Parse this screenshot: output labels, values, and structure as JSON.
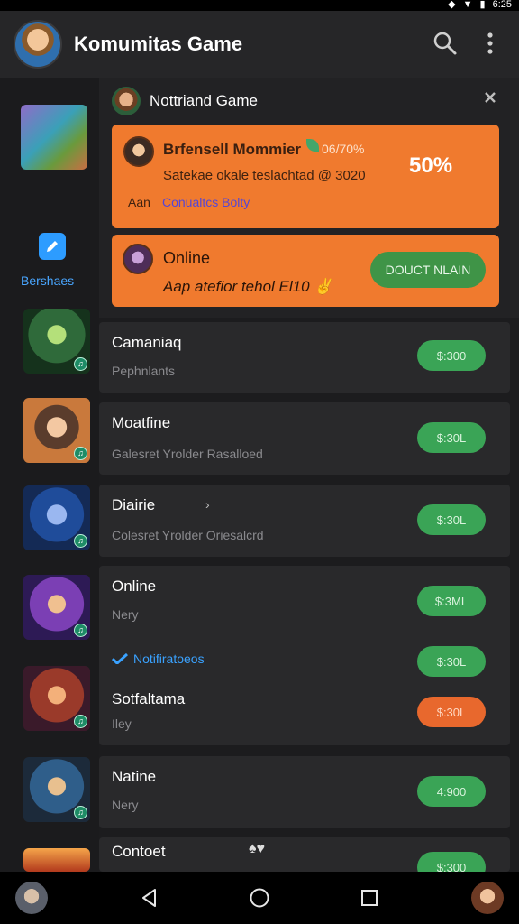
{
  "status_bar": {
    "time": "6:25"
  },
  "appbar": {
    "title": "Komumitas Game",
    "icons": [
      "search-icon",
      "more-vert-icon"
    ]
  },
  "sidebar": {
    "nav_label": "Bershaes"
  },
  "notification_panel": {
    "title": "Nottriand Game",
    "card1": {
      "title": "Brfensell Mommier",
      "meta": "06/70%",
      "text": "Satekae okale teslachtad @ 3020",
      "percent": "50%",
      "sub_prefix": "Aan",
      "sub_link": "Conualtcs Bolty"
    },
    "card2": {
      "title": "Online",
      "text": "Aap atefior tehol El10 ✌",
      "button": "DOUCT NLAIN"
    }
  },
  "rows": [
    {
      "title": "Camaniaq",
      "sub": "Pephnlants",
      "price": "$:300"
    },
    {
      "title": "Moatfine",
      "sub": "Galesret Yrolder Rasalloed",
      "price": "$:30L"
    },
    {
      "title": "Diairie",
      "sub": "Colesret Yrolder Oriesalcrd",
      "price": "$:30L"
    },
    {
      "title": "Online",
      "sub": "Nery",
      "price": "$:3ML",
      "notif": "Notifiratoeos",
      "price2": "$:30L"
    },
    {
      "title": "Sotfaltama",
      "sub": "Iley",
      "price": "$:30L"
    },
    {
      "title": "Natine",
      "sub": "Nery",
      "price": "4:900"
    },
    {
      "title": "Contoet",
      "sub": "",
      "price": "$:300"
    }
  ],
  "colors": {
    "accent_orange": "#f07a2e",
    "accent_green": "#3aa456",
    "accent_blue": "#2d9cff"
  }
}
